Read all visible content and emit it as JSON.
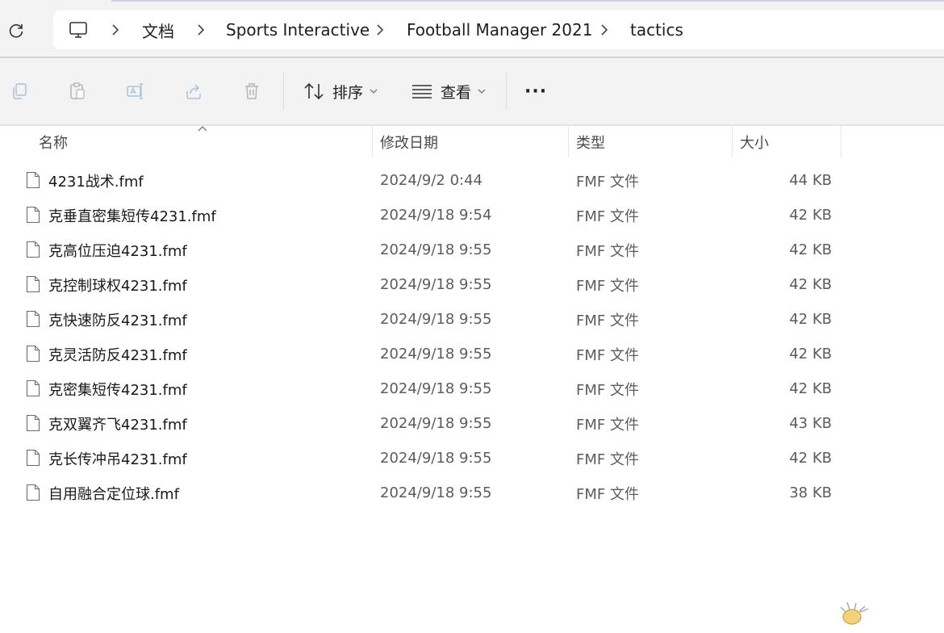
{
  "address_bar": {
    "crumbs": [
      "文档",
      "Sports Interactive",
      "Football Manager 2021",
      "tactics"
    ]
  },
  "toolbar": {
    "sort_label": "排序",
    "view_label": "查看",
    "more_label": "···"
  },
  "columns": {
    "name": "名称",
    "date": "修改日期",
    "type": "类型",
    "size": "大小"
  },
  "files": [
    {
      "name": "4231战术.fmf",
      "date": "2024/9/2 0:44",
      "type": "FMF 文件",
      "size": "44 KB"
    },
    {
      "name": "克垂直密集短传4231.fmf",
      "date": "2024/9/18 9:54",
      "type": "FMF 文件",
      "size": "42 KB"
    },
    {
      "name": "克高位压迫4231.fmf",
      "date": "2024/9/18 9:55",
      "type": "FMF 文件",
      "size": "42 KB"
    },
    {
      "name": "克控制球权4231.fmf",
      "date": "2024/9/18 9:55",
      "type": "FMF 文件",
      "size": "42 KB"
    },
    {
      "name": "克快速防反4231.fmf",
      "date": "2024/9/18 9:55",
      "type": "FMF 文件",
      "size": "42 KB"
    },
    {
      "name": "克灵活防反4231.fmf",
      "date": "2024/9/18 9:55",
      "type": "FMF 文件",
      "size": "42 KB"
    },
    {
      "name": "克密集短传4231.fmf",
      "date": "2024/9/18 9:55",
      "type": "FMF 文件",
      "size": "42 KB"
    },
    {
      "name": "克双翼齐飞4231.fmf",
      "date": "2024/9/18 9:55",
      "type": "FMF 文件",
      "size": "43 KB"
    },
    {
      "name": "克长传冲吊4231.fmf",
      "date": "2024/9/18 9:55",
      "type": "FMF 文件",
      "size": "42 KB"
    },
    {
      "name": "自用融合定位球.fmf",
      "date": "2024/9/18 9:55",
      "type": "FMF 文件",
      "size": "38 KB"
    }
  ]
}
